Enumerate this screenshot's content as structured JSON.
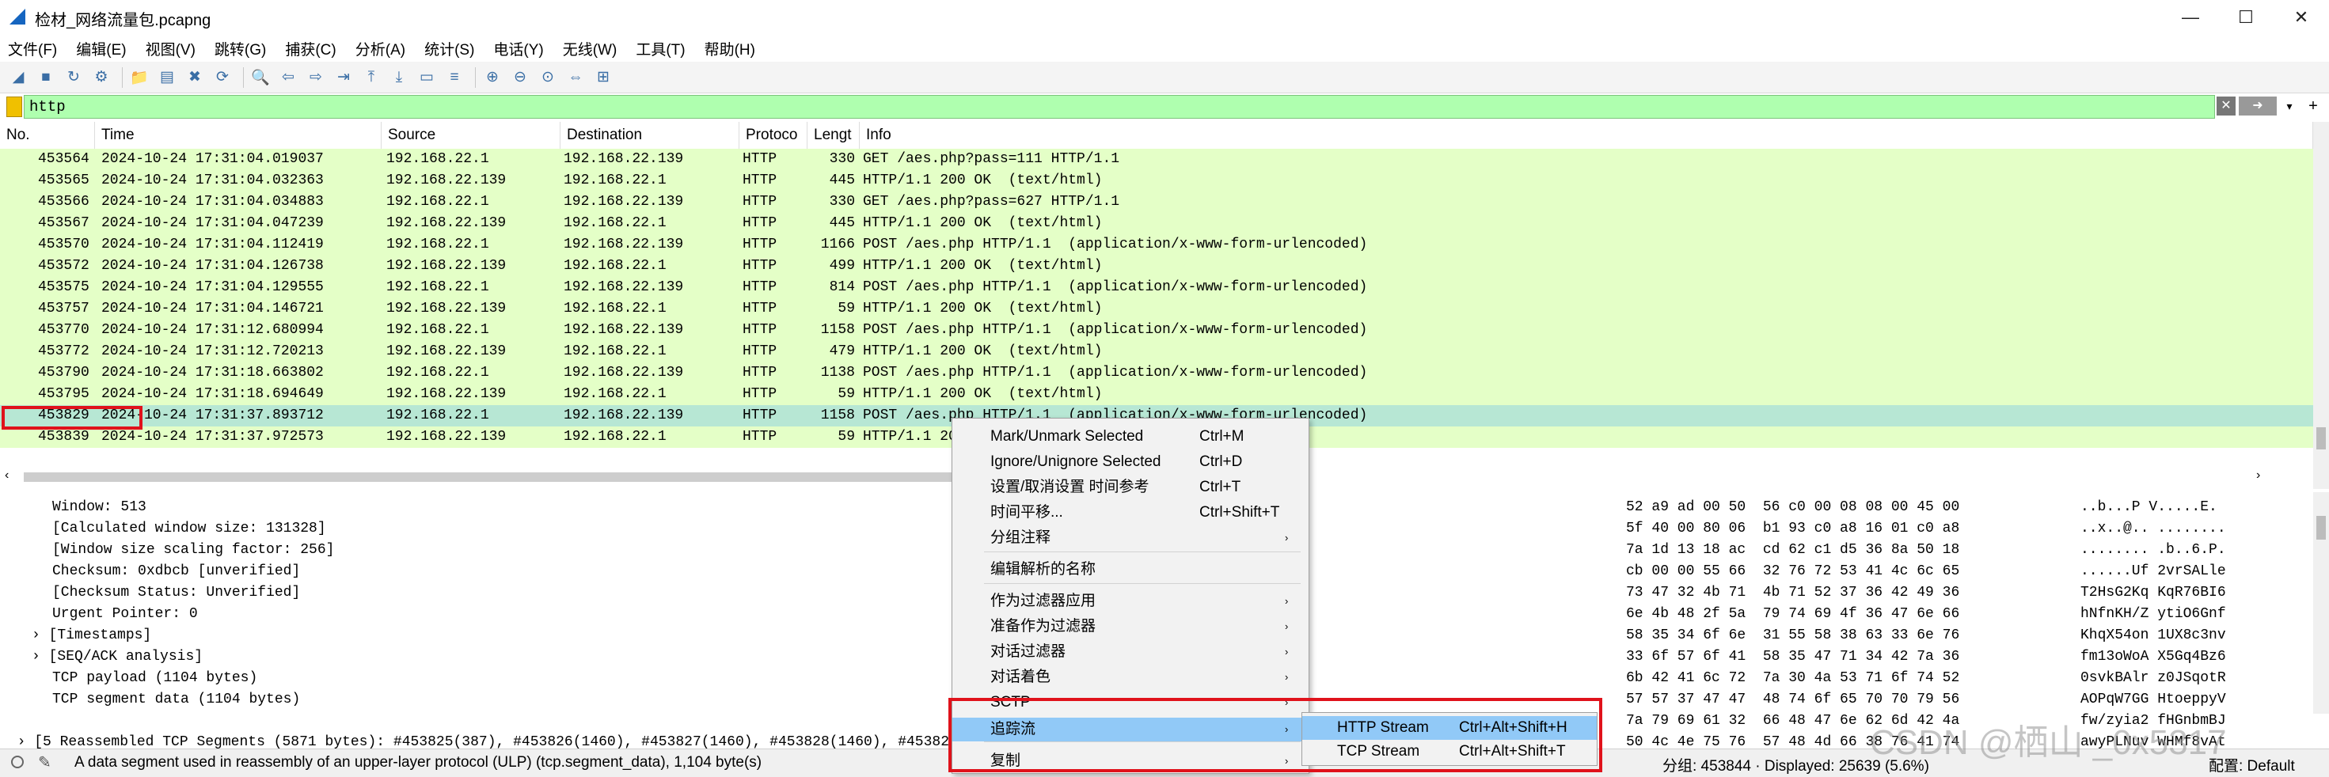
{
  "window": {
    "title": "检材_网络流量包.pcapng",
    "minimize": "—",
    "maximize": "☐",
    "close": "✕"
  },
  "menubar": [
    "文件(F)",
    "编辑(E)",
    "视图(V)",
    "跳转(G)",
    "捕获(C)",
    "分析(A)",
    "统计(S)",
    "电话(Y)",
    "无线(W)",
    "工具(T)",
    "帮助(H)"
  ],
  "filter": {
    "value": "http",
    "clear_icon": "✕",
    "apply_icon": "➜",
    "dropdown_icon": "▾",
    "add_icon": "+"
  },
  "columns": [
    "No.",
    "Time",
    "Source",
    "Destination",
    "Protoco",
    "Lengt",
    "Info"
  ],
  "packets": [
    {
      "no": "453564",
      "time": "2024-10-24 17:31:04.019037",
      "src": "192.168.22.1",
      "dst": "192.168.22.139",
      "proto": "HTTP",
      "len": "330",
      "info": "GET /aes.php?pass=111 HTTP/1.1"
    },
    {
      "no": "453565",
      "time": "2024-10-24 17:31:04.032363",
      "src": "192.168.22.139",
      "dst": "192.168.22.1",
      "proto": "HTTP",
      "len": "445",
      "info": "HTTP/1.1 200 OK  (text/html)"
    },
    {
      "no": "453566",
      "time": "2024-10-24 17:31:04.034883",
      "src": "192.168.22.1",
      "dst": "192.168.22.139",
      "proto": "HTTP",
      "len": "330",
      "info": "GET /aes.php?pass=627 HTTP/1.1"
    },
    {
      "no": "453567",
      "time": "2024-10-24 17:31:04.047239",
      "src": "192.168.22.139",
      "dst": "192.168.22.1",
      "proto": "HTTP",
      "len": "445",
      "info": "HTTP/1.1 200 OK  (text/html)"
    },
    {
      "no": "453570",
      "time": "2024-10-24 17:31:04.112419",
      "src": "192.168.22.1",
      "dst": "192.168.22.139",
      "proto": "HTTP",
      "len": "1166",
      "info": "POST /aes.php HTTP/1.1  (application/x-www-form-urlencoded)"
    },
    {
      "no": "453572",
      "time": "2024-10-24 17:31:04.126738",
      "src": "192.168.22.139",
      "dst": "192.168.22.1",
      "proto": "HTTP",
      "len": "499",
      "info": "HTTP/1.1 200 OK  (text/html)"
    },
    {
      "no": "453575",
      "time": "2024-10-24 17:31:04.129555",
      "src": "192.168.22.1",
      "dst": "192.168.22.139",
      "proto": "HTTP",
      "len": "814",
      "info": "POST /aes.php HTTP/1.1  (application/x-www-form-urlencoded)"
    },
    {
      "no": "453757",
      "time": "2024-10-24 17:31:04.146721",
      "src": "192.168.22.139",
      "dst": "192.168.22.1",
      "proto": "HTTP",
      "len": "59",
      "info": "HTTP/1.1 200 OK  (text/html)"
    },
    {
      "no": "453770",
      "time": "2024-10-24 17:31:12.680994",
      "src": "192.168.22.1",
      "dst": "192.168.22.139",
      "proto": "HTTP",
      "len": "1158",
      "info": "POST /aes.php HTTP/1.1  (application/x-www-form-urlencoded)"
    },
    {
      "no": "453772",
      "time": "2024-10-24 17:31:12.720213",
      "src": "192.168.22.139",
      "dst": "192.168.22.1",
      "proto": "HTTP",
      "len": "479",
      "info": "HTTP/1.1 200 OK  (text/html)"
    },
    {
      "no": "453790",
      "time": "2024-10-24 17:31:18.663802",
      "src": "192.168.22.1",
      "dst": "192.168.22.139",
      "proto": "HTTP",
      "len": "1138",
      "info": "POST /aes.php HTTP/1.1  (application/x-www-form-urlencoded)"
    },
    {
      "no": "453795",
      "time": "2024-10-24 17:31:18.694649",
      "src": "192.168.22.139",
      "dst": "192.168.22.1",
      "proto": "HTTP",
      "len": "59",
      "info": "HTTP/1.1 200 OK  (text/html)"
    },
    {
      "no": "453829",
      "time": "2024-10-24 17:31:37.893712",
      "src": "192.168.22.1",
      "dst": "192.168.22.139",
      "proto": "HTTP",
      "len": "1158",
      "info": "POST /aes.php HTTP/1.1  (application/x-www-form-urlencoded)"
    },
    {
      "no": "453839",
      "time": "2024-10-24 17:31:37.972573",
      "src": "192.168.22.139",
      "dst": "192.168.22.1",
      "proto": "HTTP",
      "len": "59",
      "info": "HTTP/1.1 200 OK  (text/html)"
    }
  ],
  "details": [
    "Window: 513",
    "[Calculated window size: 131328]",
    "[Window size scaling factor: 256]",
    "Checksum: 0xdbcb [unverified]",
    "[Checksum Status: Unverified]",
    "Urgent Pointer: 0",
    "[Timestamps]",
    "[SEQ/ACK analysis]",
    "TCP payload (1104 bytes)",
    "TCP segment data (1104 bytes)"
  ],
  "reassembled": "[5 Reassembled TCP Segments (5871 bytes): #453825(387), #453826(1460), #453827(1460), #453828(1460), #453829",
  "bytes": [
    {
      "hex": "52 a9 ad 00 50  56 c0 00 08 08 00 45 00",
      "ascii": "..b...P V.....E."
    },
    {
      "hex": "5f 40 00 80 06  b1 93 c0 a8 16 01 c0 a8",
      "ascii": "..x..@.. ........"
    },
    {
      "hex": "7a 1d 13 18 ac  cd 62 c1 d5 36 8a 50 18",
      "ascii": "........ .b..6.P."
    },
    {
      "hex": "cb 00 00 55 66  32 76 72 53 41 4c 6c 65",
      "ascii": "......Uf 2vrSALle"
    },
    {
      "hex": "73 47 32 4b 71  4b 71 52 37 36 42 49 36",
      "ascii": "T2HsG2Kq KqR76BI6"
    },
    {
      "hex": "6e 4b 48 2f 5a  79 74 69 4f 36 47 6e 66",
      "ascii": "hNfnKH/Z ytiO6Gnf"
    },
    {
      "hex": "58 35 34 6f 6e  31 55 58 38 63 33 6e 76",
      "ascii": "KhqX54on 1UX8c3nv"
    },
    {
      "hex": "33 6f 57 6f 41  58 35 47 71 34 42 7a 36",
      "ascii": "fm13oWoA X5Gq4Bz6"
    },
    {
      "hex": "6b 42 41 6c 72  7a 30 4a 53 71 6f 74 52",
      "ascii": "0svkBAlr z0JSqotR"
    },
    {
      "hex": "57 57 37 47 47  48 74 6f 65 70 70 79 56",
      "ascii": "AOPqW7GG HtoeppyV"
    },
    {
      "hex": "7a 79 69 61 32  66 48 47 6e 62 6d 42 4a",
      "ascii": "fw/zyia2 fHGnbmBJ"
    },
    {
      "hex": "50 4c 4e 75 76  57 48 4d 66 38 76 41 74",
      "ascii": "awyPLNuv WHMf8vAt"
    }
  ],
  "context_menu": [
    {
      "label": "Mark/Unmark Selected",
      "shortcut": "Ctrl+M",
      "arrow": ""
    },
    {
      "label": "Ignore/Unignore Selected",
      "shortcut": "Ctrl+D",
      "arrow": ""
    },
    {
      "label": "设置/取消设置 时间参考",
      "shortcut": "Ctrl+T",
      "arrow": ""
    },
    {
      "label": "时间平移...",
      "shortcut": "Ctrl+Shift+T",
      "arrow": ""
    },
    {
      "label": "分组注释",
      "shortcut": "",
      "arrow": "›"
    },
    {
      "label": "编辑解析的名称",
      "shortcut": "",
      "arrow": ""
    },
    {
      "label": "作为过滤器应用",
      "shortcut": "",
      "arrow": "›"
    },
    {
      "label": "准备作为过滤器",
      "shortcut": "",
      "arrow": "›"
    },
    {
      "label": "对话过滤器",
      "shortcut": "",
      "arrow": "›"
    },
    {
      "label": "对话着色",
      "shortcut": "",
      "arrow": "›"
    },
    {
      "label": "SCTP",
      "shortcut": "",
      "arrow": "›"
    },
    {
      "label": "追踪流",
      "shortcut": "",
      "arrow": "›"
    },
    {
      "label": "复制",
      "shortcut": "",
      "arrow": "›"
    }
  ],
  "submenu": [
    {
      "label": "HTTP Stream",
      "shortcut": "Ctrl+Alt+Shift+H"
    },
    {
      "label": "TCP Stream",
      "shortcut": "Ctrl+Alt+Shift+T"
    }
  ],
  "status": {
    "message": "A data segment used in reassembly of an upper-layer protocol (ULP) (tcp.segment_data), 1,104 byte(s)",
    "counts": "分组: 453844 · Displayed: 25639 (5.6%)",
    "profile": "配置:  Default"
  },
  "watermark": "CSDN @栖山 _0x5317",
  "colors": {
    "row_green": "#e4ffc7",
    "row_selected": "#b7e7d4",
    "filter_green": "#afffaf",
    "highlight_box": "#e0121b",
    "menu_highlight": "#91c9f7"
  }
}
